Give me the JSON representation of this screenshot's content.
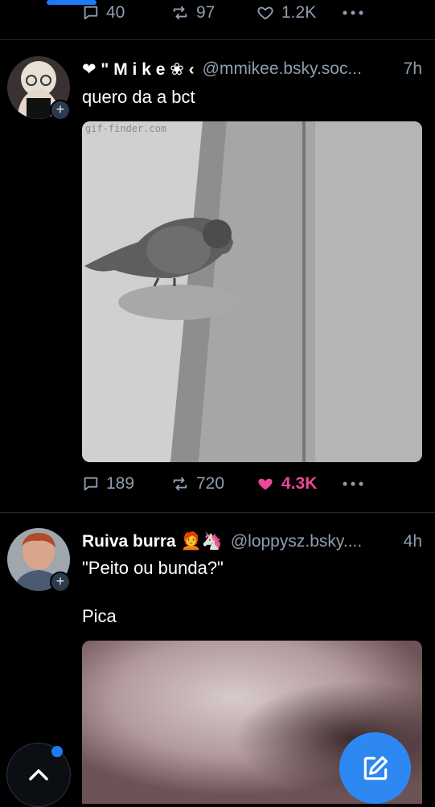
{
  "prev_post": {
    "reply_count": "40",
    "repost_count": "97",
    "like_count": "1.2K"
  },
  "post1": {
    "display_name": "❤ \" M i k e ❀ ‹",
    "handle": "@mmikee.bsky.soc...",
    "time": "7h",
    "text": "quero da a bct",
    "watermark": "gif-finder.com",
    "reply_count": "189",
    "repost_count": "720",
    "like_count": "4.3K",
    "liked": true
  },
  "post2": {
    "display_name": "Ruiva burra 🧑‍🦰🦄",
    "handle": "@loppysz.bsky....",
    "time": "4h",
    "text": "\"Peito ou bunda?\"\n\nPica"
  },
  "colors": {
    "accent": "#1d7bf5",
    "like": "#ec4899",
    "muted": "#8f9eb0",
    "compose_button": "#2e88f2"
  }
}
